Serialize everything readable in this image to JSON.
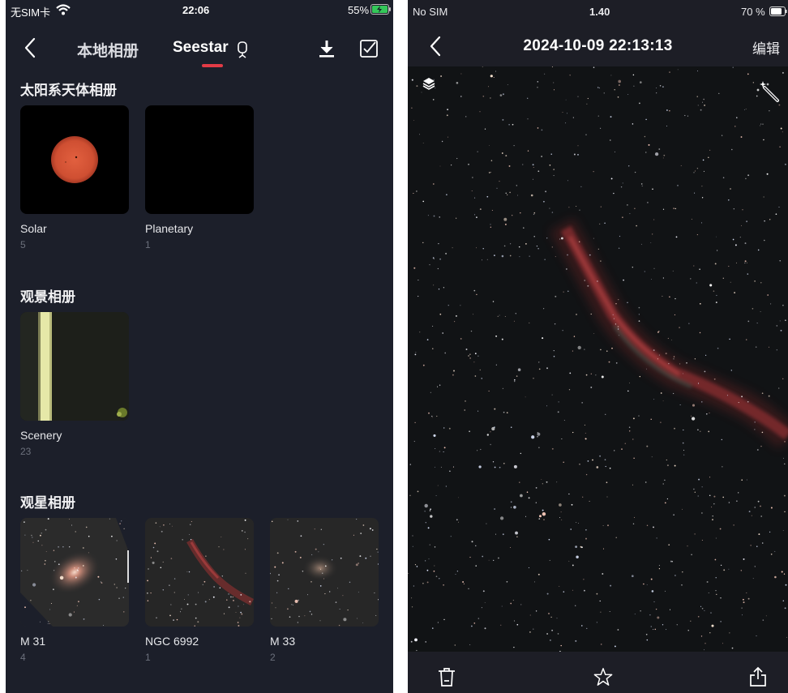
{
  "left": {
    "status": {
      "carrier": "无SIM卡",
      "time": "22:06",
      "battery": "55%"
    },
    "nav": {
      "tab_local": "本地相册",
      "tab_seestar": "Seestar"
    },
    "sections": [
      {
        "title": "太阳系天体相册",
        "albums": [
          {
            "name": "Solar",
            "count": "5"
          },
          {
            "name": "Planetary",
            "count": "1"
          }
        ]
      },
      {
        "title": "观景相册",
        "albums": [
          {
            "name": "Scenery",
            "count": "23"
          }
        ]
      },
      {
        "title": "观星相册",
        "albums": [
          {
            "name": "M 31",
            "count": "4"
          },
          {
            "name": "NGC 6992",
            "count": "1"
          },
          {
            "name": "M 33",
            "count": "2"
          }
        ]
      }
    ]
  },
  "right": {
    "status": {
      "carrier": "No SIM",
      "time": "1.40",
      "battery": "70 %"
    },
    "title": "2024-10-09  22:13:13",
    "edit_label": "编辑"
  },
  "icons": [
    "back-icon",
    "telescope-icon",
    "download-icon",
    "select-icon",
    "layers-icon",
    "magic-wand-icon",
    "trash-icon",
    "star-icon",
    "share-icon",
    "wifi-icon",
    "battery-icon"
  ],
  "colors": {
    "left_bg": "#1c1f2a",
    "right_bg": "#1d1e26",
    "accent": "#e23b46",
    "solar": "#d2543a",
    "nebula": "#b53a3a"
  }
}
